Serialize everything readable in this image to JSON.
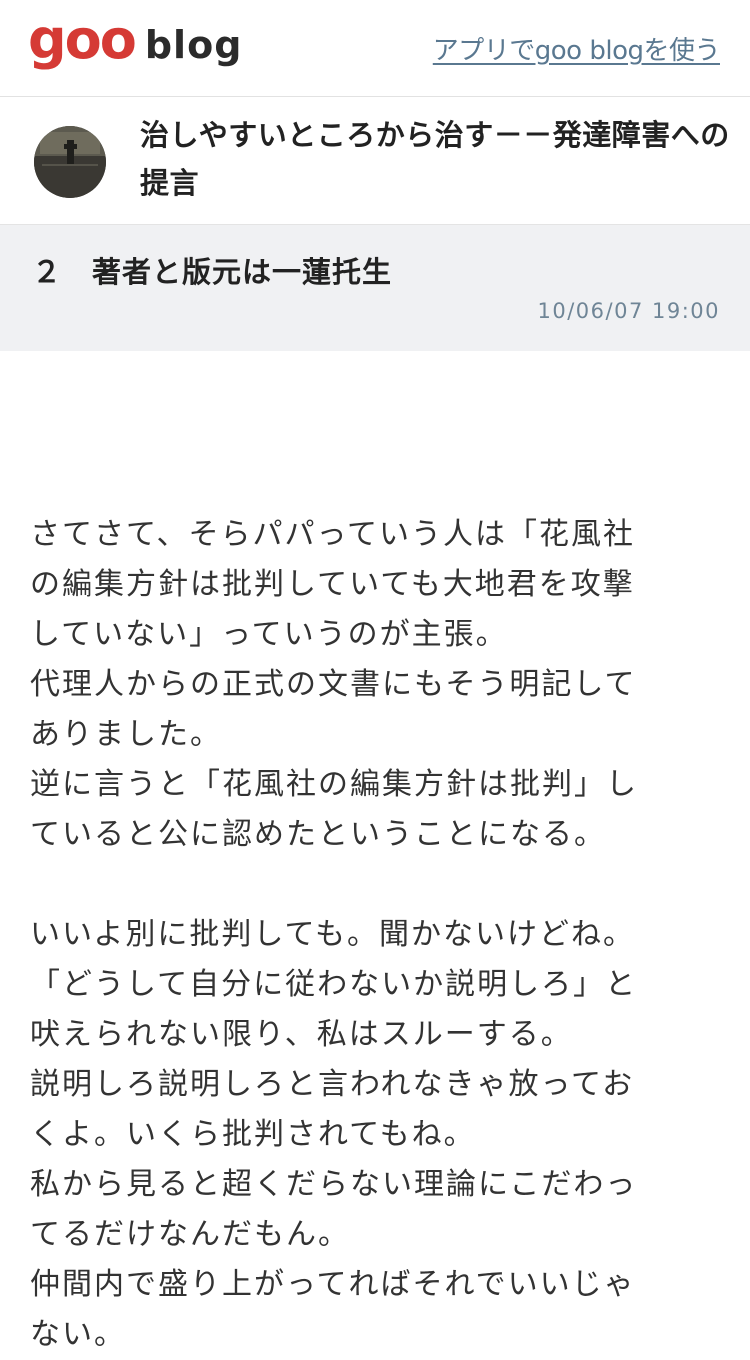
{
  "header": {
    "logo_goo": "goo",
    "logo_blog": "blog",
    "app_link": "アプリでgoo blogを使う"
  },
  "blog": {
    "title": "治しやすいところから治す－－発達障害への提言"
  },
  "entry": {
    "title": "２　著者と版元は一蓮托生",
    "date": "10/06/07 19:00",
    "lines": [
      "さてさて、そらパパっていう人は「花風社",
      "の編集方針は批判していても大地君を攻撃",
      "していない」っていうのが主張。",
      "代理人からの正式の文書にもそう明記して",
      "ありました。",
      "逆に言うと「花風社の編集方針は批判」し",
      "ていると公に認めたということになる。",
      "",
      "いいよ別に批判しても。聞かないけどね。",
      "「どうして自分に従わないか説明しろ」と",
      "吠えられない限り、私はスルーする。",
      "説明しろ説明しろと言われなきゃ放ってお",
      "くよ。いくら批判されてもね。",
      "私から見ると超くだらない理論にこだわっ",
      "てるだけなんだもん。",
      "仲間内で盛り上がってればそれでいいじゃ",
      "ない。"
    ]
  },
  "colors": {
    "logo_red": "#d53a35",
    "link": "#5a7890",
    "entry_header_bg": "#f0f1f3"
  }
}
